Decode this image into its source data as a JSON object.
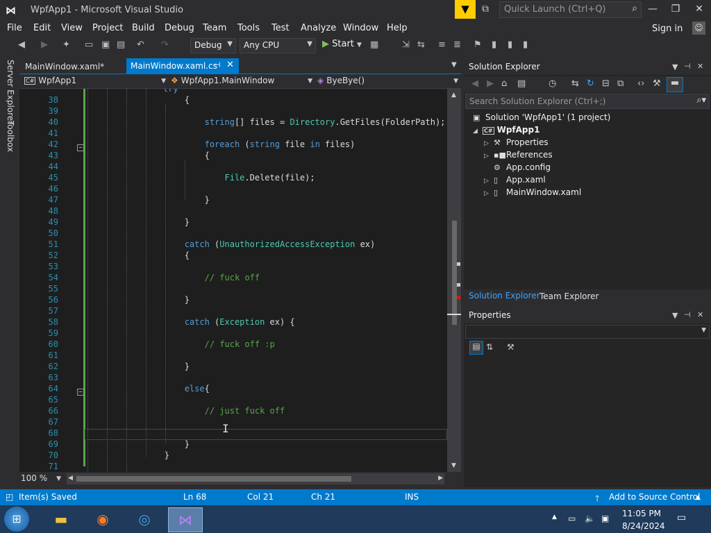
{
  "window": {
    "title": "WpfApp1 - Microsoft Visual Studio",
    "quick_launch_placeholder": "Quick Launch (Ctrl+Q)"
  },
  "menu": [
    "File",
    "Edit",
    "View",
    "Project",
    "Build",
    "Debug",
    "Team",
    "Tools",
    "Test",
    "Analyze",
    "Window",
    "Help"
  ],
  "signin": "Sign in",
  "toolbar": {
    "config": "Debug",
    "platform": "Any CPU",
    "start": "Start"
  },
  "left_rail": [
    "Server Explorer",
    "Toolbox"
  ],
  "doc_tabs": [
    {
      "label": "MainWindow.xaml*",
      "active": false
    },
    {
      "label": "MainWindow.xaml.cs",
      "active": true
    }
  ],
  "navbar": {
    "project": "WpfApp1",
    "class": "WpfApp1.MainWindow",
    "member": "ByeBye()"
  },
  "code_lines": [
    {
      "n": "38",
      "t": "            {"
    },
    {
      "n": "39",
      "t": ""
    },
    {
      "n": "40",
      "t": "                string[] files = Directory.GetFiles(FolderPath);"
    },
    {
      "n": "41",
      "t": ""
    },
    {
      "n": "42",
      "t": "                foreach (string file in files)"
    },
    {
      "n": "43",
      "t": "                {"
    },
    {
      "n": "44",
      "t": ""
    },
    {
      "n": "45",
      "t": "                    File.Delete(file);"
    },
    {
      "n": "46",
      "t": ""
    },
    {
      "n": "47",
      "t": "                }"
    },
    {
      "n": "48",
      "t": ""
    },
    {
      "n": "49",
      "t": "            }"
    },
    {
      "n": "50",
      "t": ""
    },
    {
      "n": "51",
      "t": "            catch (UnauthorizedAccessException ex)"
    },
    {
      "n": "52",
      "t": "            {"
    },
    {
      "n": "53",
      "t": ""
    },
    {
      "n": "54",
      "t": "                // fuck off"
    },
    {
      "n": "55",
      "t": ""
    },
    {
      "n": "56",
      "t": "            }"
    },
    {
      "n": "57",
      "t": ""
    },
    {
      "n": "58",
      "t": "            catch (Exception ex) {"
    },
    {
      "n": "59",
      "t": ""
    },
    {
      "n": "60",
      "t": "                // fuck off :p"
    },
    {
      "n": "61",
      "t": ""
    },
    {
      "n": "62",
      "t": "            }"
    },
    {
      "n": "63",
      "t": ""
    },
    {
      "n": "64",
      "t": "            else{"
    },
    {
      "n": "65",
      "t": ""
    },
    {
      "n": "66",
      "t": "                // just fuck off"
    },
    {
      "n": "67",
      "t": ""
    },
    {
      "n": "68",
      "t": ""
    },
    {
      "n": "69",
      "t": "            }"
    },
    {
      "n": "70",
      "t": "        }"
    },
    {
      "n": "71",
      "t": ""
    }
  ],
  "top_partial": "try",
  "zoom": "100 %",
  "solution_explorer": {
    "title": "Solution Explorer",
    "search_placeholder": "Search Solution Explorer (Ctrl+;)",
    "tree": [
      {
        "label": "Solution 'WpfApp1' (1 project)",
        "icon": "solution-icon"
      },
      {
        "label": "WpfApp1",
        "icon": "csharp-project-icon"
      },
      {
        "label": "Properties",
        "icon": "wrench-icon"
      },
      {
        "label": "References",
        "icon": "references-icon"
      },
      {
        "label": "App.config",
        "icon": "config-file-icon"
      },
      {
        "label": "App.xaml",
        "icon": "xaml-file-icon"
      },
      {
        "label": "MainWindow.xaml",
        "icon": "xaml-file-icon"
      }
    ],
    "tabs": [
      "Solution Explorer",
      "Team Explorer"
    ]
  },
  "properties": {
    "title": "Properties"
  },
  "status": {
    "message": "Item(s) Saved",
    "ln": "Ln 68",
    "col": "Col 21",
    "ch": "Ch 21",
    "mode": "INS",
    "source_control": "Add to Source Control"
  },
  "taskbar": {
    "time": "11:05 PM",
    "date": "8/24/2024"
  },
  "colors": {
    "accent": "#007acc",
    "keyword": "#569cd6",
    "type": "#4ec9b0",
    "comment": "#57a64a",
    "line_number": "#2b91af"
  }
}
